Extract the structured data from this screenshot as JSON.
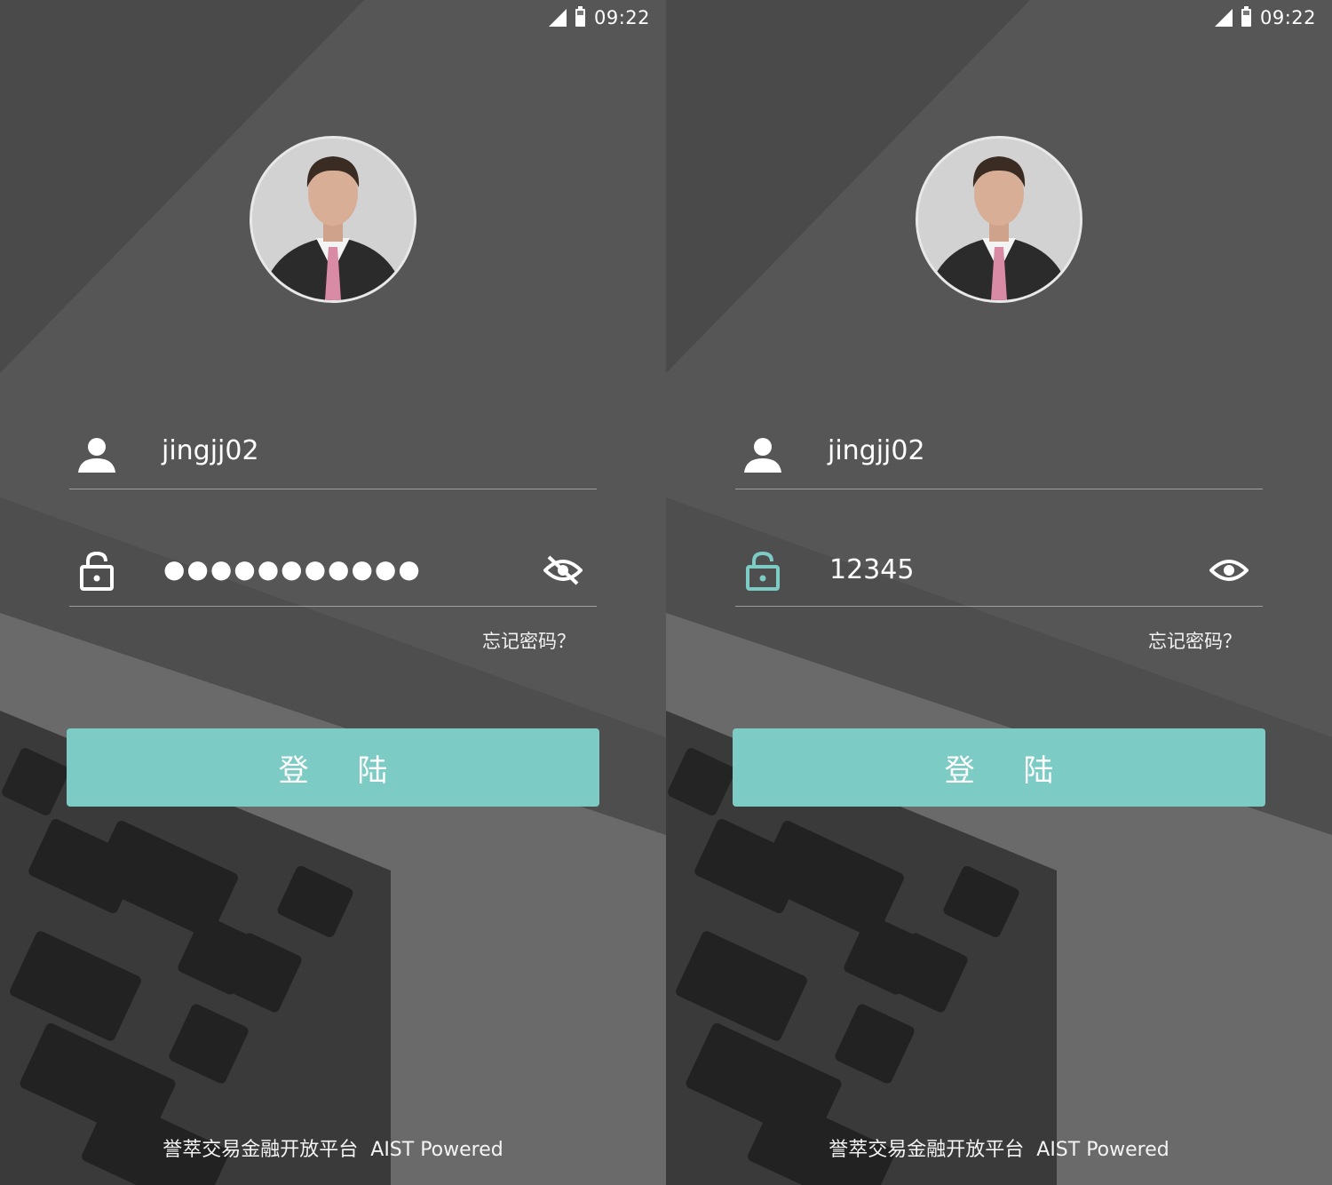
{
  "status_bar": {
    "time": "09:22"
  },
  "screens": [
    {
      "username": "jingjj02",
      "password_masked": "●●●●●●●●●●●",
      "password_visible": false,
      "forgot_label": "忘记密码？",
      "login_label": "登 陆",
      "footer_platform": "誉萃交易金融开放平台",
      "footer_powered": "AIST Powered"
    },
    {
      "username": "jingjj02",
      "password_plain": "12345",
      "password_visible": true,
      "forgot_label": "忘记密码？",
      "login_label": "登 陆",
      "footer_platform": "誉萃交易金融开放平台",
      "footer_powered": "AIST Powered"
    }
  ],
  "colors": {
    "accent": "#7ccbc4",
    "lock_active": "#7ccbc4",
    "text": "#ffffff"
  },
  "icons": [
    "signal-icon",
    "battery-icon",
    "user-icon",
    "lock-icon",
    "eye-off-icon",
    "eye-icon"
  ]
}
